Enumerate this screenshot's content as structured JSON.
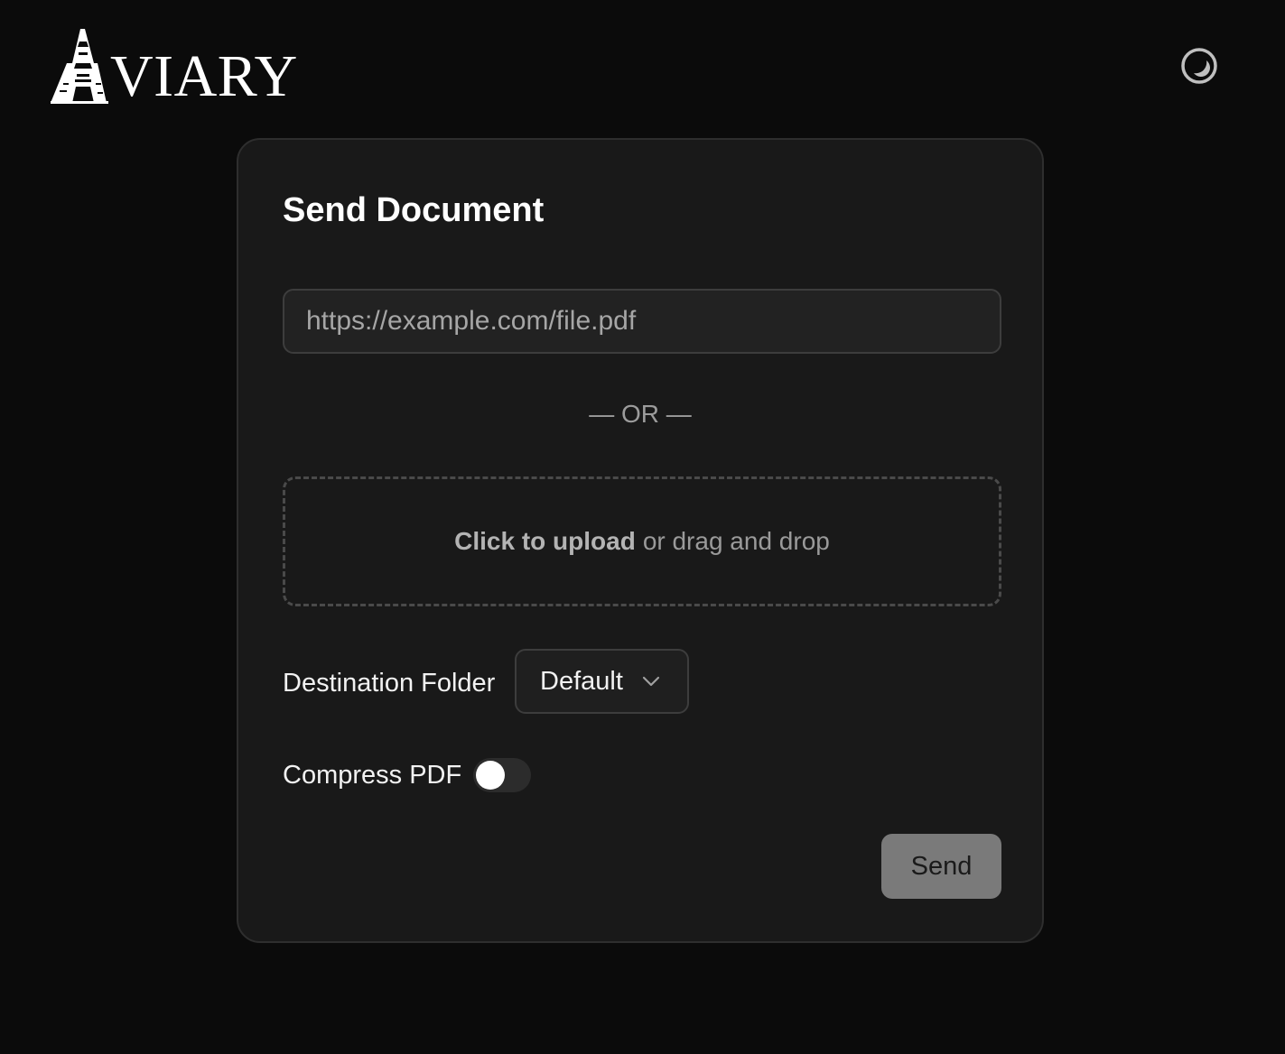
{
  "header": {
    "logo_text": "VIARY",
    "logo_initial": "A",
    "theme_toggle_icon": "moon-icon"
  },
  "form": {
    "title": "Send Document",
    "url_input": {
      "value": "",
      "placeholder": "https://example.com/file.pdf"
    },
    "separator": "— OR —",
    "upload": {
      "action_text": "Click to upload",
      "rest_text": "or drag and drop"
    },
    "destination_folder": {
      "label": "Destination Folder",
      "selected": "Default",
      "icon": "chevron-down-icon"
    },
    "compress_pdf": {
      "label": "Compress PDF",
      "enabled": false
    },
    "send_label": "Send"
  },
  "colors": {
    "background": "#0b0b0b",
    "card": "#191919",
    "send_button": "#7a7a7a"
  }
}
